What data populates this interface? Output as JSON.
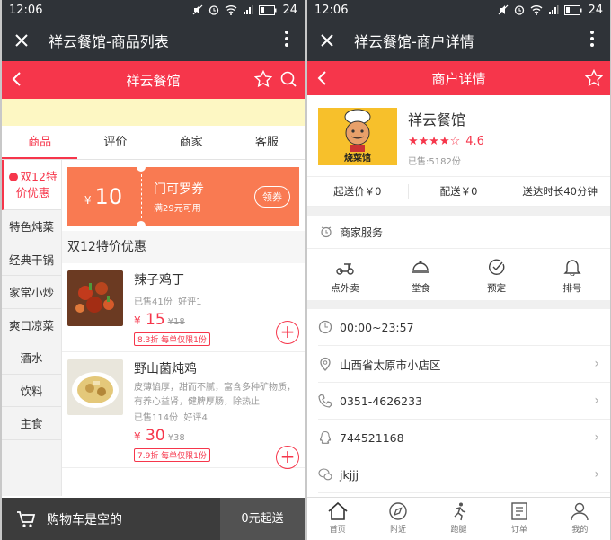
{
  "left": {
    "status": {
      "time": "12:06",
      "battery": "24"
    },
    "window_title": "祥云餐馆-商品列表",
    "header_title": "祥云餐馆",
    "tabs": [
      {
        "label": "商品"
      },
      {
        "label": "评价"
      },
      {
        "label": "商家"
      },
      {
        "label": "客服"
      }
    ],
    "categories": [
      {
        "label": "双12特价优惠"
      },
      {
        "label": "特色炖菜"
      },
      {
        "label": "经典干锅"
      },
      {
        "label": "家常小炒"
      },
      {
        "label": "爽口凉菜"
      },
      {
        "label": "酒水"
      },
      {
        "label": "饮料"
      },
      {
        "label": "主食"
      }
    ],
    "coupon": {
      "currency": "¥",
      "amount": "10",
      "name": "门可罗券",
      "condition": "满29元可用",
      "button": "领券"
    },
    "section_title": "双12特价优惠",
    "dishes": [
      {
        "name": "辣子鸡丁",
        "sold": "已售41份",
        "rating": "好评1",
        "desc": "",
        "currency": "¥",
        "price": "15",
        "old_price": "¥18",
        "discount": "8.3折 每单仅限1份"
      },
      {
        "name": "野山菌炖鸡",
        "sold": "已售114份",
        "rating": "好评4",
        "desc": "皮薄馅厚，甜而不腻，富含多种矿物质，有养心益肾，健脾厚肠，除热止",
        "currency": "¥",
        "price": "30",
        "old_price": "¥38",
        "discount": "7.9折 每单仅限1份"
      }
    ],
    "cart": {
      "label": "购物车是空的",
      "min_order": "0元起送"
    }
  },
  "right": {
    "status": {
      "time": "12:06",
      "battery": "24"
    },
    "window_title": "祥云餐馆-商户详情",
    "header_title": "商户详情",
    "shop": {
      "name": "祥云餐馆",
      "score": "4.6",
      "rating_value": 4.6,
      "sold": "已售:5182份",
      "logo_text": "烧菜馆"
    },
    "delivery": [
      {
        "text": "起送价￥0"
      },
      {
        "text": "配送￥0"
      },
      {
        "text": "送达时长40分钟"
      }
    ],
    "services_title": "商家服务",
    "services": [
      {
        "label": "点外卖"
      },
      {
        "label": "堂食"
      },
      {
        "label": "预定"
      },
      {
        "label": "排号"
      }
    ],
    "info": [
      {
        "text": "00:00~23:57"
      },
      {
        "text": "山西省太原市小店区"
      },
      {
        "text": "0351-4626233"
      },
      {
        "text": "744521168"
      },
      {
        "text": "jkjjj"
      }
    ],
    "nav": [
      {
        "label": "首页"
      },
      {
        "label": "附近"
      },
      {
        "label": "跑腿"
      },
      {
        "label": "订单"
      },
      {
        "label": "我的"
      }
    ]
  },
  "colors": {
    "accent": "#f6364b",
    "dark": "#2f3338",
    "coupon": "#f97a52",
    "notice": "#fdf7c3"
  }
}
